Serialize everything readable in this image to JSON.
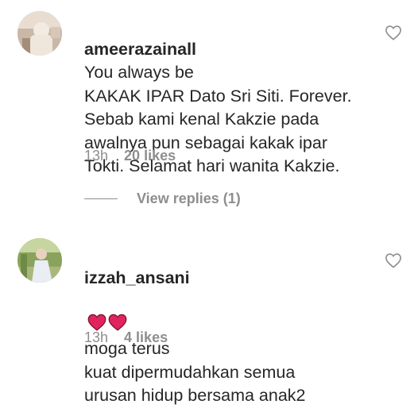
{
  "comments": [
    {
      "username": "ameerazainall",
      "text": "You always be\nKAKAK IPAR Dato Sri Siti. Forever.\nSebab kami kenal Kakzie pada\nawalnya pun sebagai kakak ipar\nTokti. Selamat hari wanita Kakzie.",
      "time": "13h",
      "likes": "20 likes",
      "view_replies": "View replies (1)"
    },
    {
      "username": "izzah_ansani",
      "text_prefix_emoji": "heart-emoji x2",
      "text": "moga terus\nkuat dipermudahkan semua\nurusan hidup bersama anak2",
      "time": "13h",
      "likes": "4 likes"
    }
  ],
  "colors": {
    "primary_text": "#262626",
    "secondary_text": "#8e8e8e",
    "heart_emoji": "#e0245e"
  },
  "icons": {
    "like": "heart-outline-icon",
    "emoji": "red-heart-emoji"
  }
}
